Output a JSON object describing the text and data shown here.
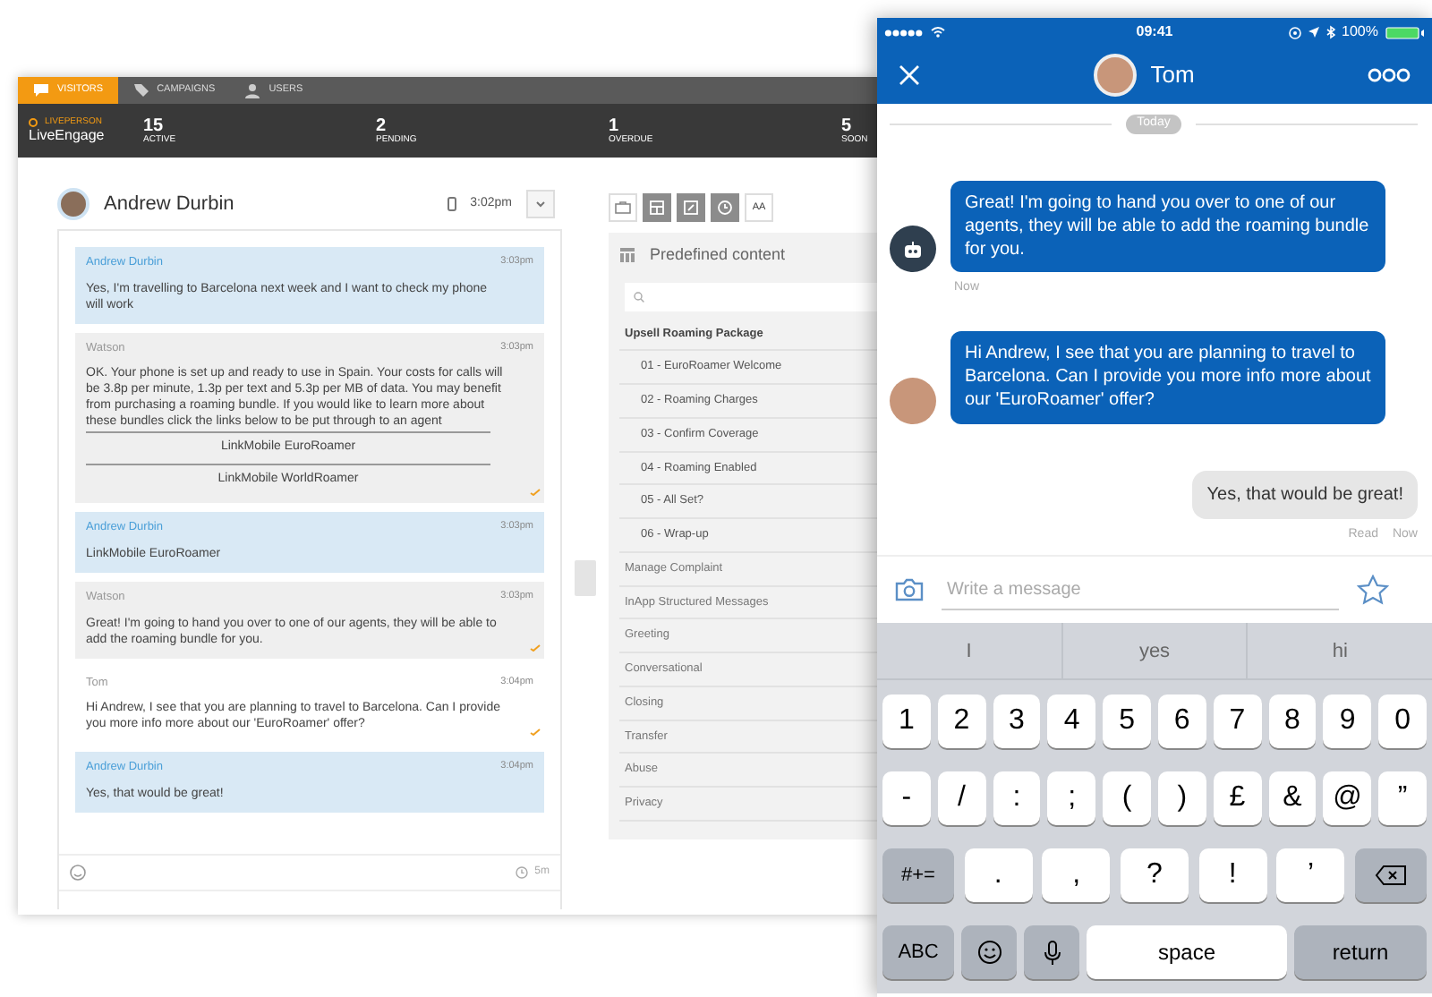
{
  "console": {
    "tabs": [
      {
        "label": "VISITORS",
        "selected": true
      },
      {
        "label": "CAMPAIGNS",
        "selected": false
      },
      {
        "label": "USERS",
        "selected": false
      }
    ],
    "logo": {
      "brand": "LIVEPERSON",
      "name": "LiveEngage"
    },
    "stats": [
      {
        "value": "15",
        "label": "ACTIVE"
      },
      {
        "value": "2",
        "label": "PENDING"
      },
      {
        "value": "1",
        "label": "OVERDUE"
      },
      {
        "value": "5",
        "label": "SOON"
      }
    ],
    "conversation": {
      "visitor": "Andrew Durbin",
      "time": "3:02pm",
      "timer": "5m",
      "messages": [
        {
          "kind": "visitor",
          "sender": "Andrew Durbin",
          "time": "3:03pm",
          "text": "Yes, I'm travelling to Barcelona next week and I want to check my phone will work",
          "delivered": false
        },
        {
          "kind": "bot",
          "sender": "Watson",
          "time": "3:03pm",
          "text": "OK. Your phone is set up and ready to use in Spain. Your costs for calls will be 3.8p per minute, 1.3p per text and 5.3p per MB of data. You may benefit from purchasing a roaming bundle. If you would like to learn more about these bundles click the links below to be put through to an agent",
          "links": [
            "LinkMobile EuroRoamer",
            "LinkMobile WorldRoamer"
          ],
          "delivered": true
        },
        {
          "kind": "visitor",
          "sender": "Andrew Durbin",
          "time": "3:03pm",
          "text": "LinkMobile EuroRoamer",
          "delivered": false
        },
        {
          "kind": "bot",
          "sender": "Watson",
          "time": "3:03pm",
          "text": "Great! I'm going to hand you over to one of our agents, they will be able to add the roaming bundle for you.",
          "delivered": true
        },
        {
          "kind": "agent",
          "sender": "Tom",
          "time": "3:04pm",
          "text": "Hi Andrew, I see that you are planning to travel to Barcelona. Can I provide you more info more about our 'EuroRoamer' offer?",
          "delivered": true
        },
        {
          "kind": "visitor",
          "sender": "Andrew Durbin",
          "time": "3:04pm",
          "text": "Yes, that would be great!",
          "delivered": false
        }
      ]
    },
    "toolbar": [
      {
        "on": false
      },
      {
        "on": true
      },
      {
        "on": true
      },
      {
        "on": true
      },
      {
        "label": "AA",
        "on": false
      }
    ],
    "predefined": {
      "title": "Predefined content",
      "categories": [
        {
          "label": "Upsell Roaming Package",
          "expanded": true,
          "children": [
            {
              "label": "01 - EuroRoamer Welcome"
            },
            {
              "label": "02 - Roaming Charges"
            },
            {
              "label": "03 - Confirm Coverage"
            },
            {
              "label": "04 - Roaming Enabled"
            },
            {
              "label": "05 - All Set?"
            },
            {
              "label": "06 - Wrap-up"
            }
          ]
        },
        {
          "label": "Manage Complaint",
          "expanded": false
        },
        {
          "label": "InApp Structured Messages",
          "expanded": false
        },
        {
          "label": "Greeting",
          "expanded": false
        },
        {
          "label": "Conversational",
          "expanded": false
        },
        {
          "label": "Closing",
          "expanded": false
        },
        {
          "label": "Transfer",
          "expanded": false
        },
        {
          "label": "Abuse",
          "expanded": false
        },
        {
          "label": "Privacy",
          "expanded": false
        }
      ]
    }
  },
  "phone": {
    "status": {
      "time": "09:41",
      "battery": "100%"
    },
    "contact": "Tom",
    "date_divider": "Today",
    "messages": [
      {
        "kind": "bot",
        "text": "Great! I'm going to hand you over to one of our agents, they will be able to add the roaming bundle for you.",
        "time": "Now"
      },
      {
        "kind": "agent",
        "text": "Hi Andrew, I see that you are planning to travel to Barcelona. Can I provide you more info more about our 'EuroRoamer' offer?"
      },
      {
        "kind": "user",
        "text": "Yes, that would be great!",
        "receipt": "Read",
        "time": "Now"
      }
    ],
    "input": {
      "placeholder": "Write a message"
    },
    "suggestions": [
      "I",
      "yes",
      "hi"
    ],
    "keyboard": [
      [
        {
          "kind": "key",
          "label": "1"
        },
        {
          "kind": "key",
          "label": "2"
        },
        {
          "kind": "key",
          "label": "3"
        },
        {
          "kind": "key",
          "label": "4"
        },
        {
          "kind": "key",
          "label": "5"
        },
        {
          "kind": "key",
          "label": "6"
        },
        {
          "kind": "key",
          "label": "7"
        },
        {
          "kind": "key",
          "label": "8"
        },
        {
          "kind": "key",
          "label": "9"
        },
        {
          "kind": "key",
          "label": "0"
        }
      ],
      [
        {
          "kind": "key",
          "label": "-"
        },
        {
          "kind": "key",
          "label": "/"
        },
        {
          "kind": "key",
          "label": ":"
        },
        {
          "kind": "key",
          "label": ";"
        },
        {
          "kind": "key",
          "label": "("
        },
        {
          "kind": "key",
          "label": ")"
        },
        {
          "kind": "key",
          "label": "£"
        },
        {
          "kind": "key",
          "label": "&"
        },
        {
          "kind": "key",
          "label": "@"
        },
        {
          "kind": "key",
          "label": "”"
        }
      ],
      [
        {
          "kind": "mod",
          "label": "#+="
        },
        {
          "kind": "wide",
          "label": "."
        },
        {
          "kind": "wide",
          "label": ","
        },
        {
          "kind": "wide",
          "label": "?"
        },
        {
          "kind": "wide",
          "label": "!"
        },
        {
          "kind": "wide",
          "label": "’"
        },
        {
          "kind": "delete"
        }
      ],
      [
        {
          "kind": "mod",
          "label": "ABC"
        },
        {
          "kind": "emoji"
        },
        {
          "kind": "dictation"
        },
        {
          "kind": "space",
          "label": "space"
        },
        {
          "kind": "return",
          "label": "return"
        }
      ]
    ]
  }
}
